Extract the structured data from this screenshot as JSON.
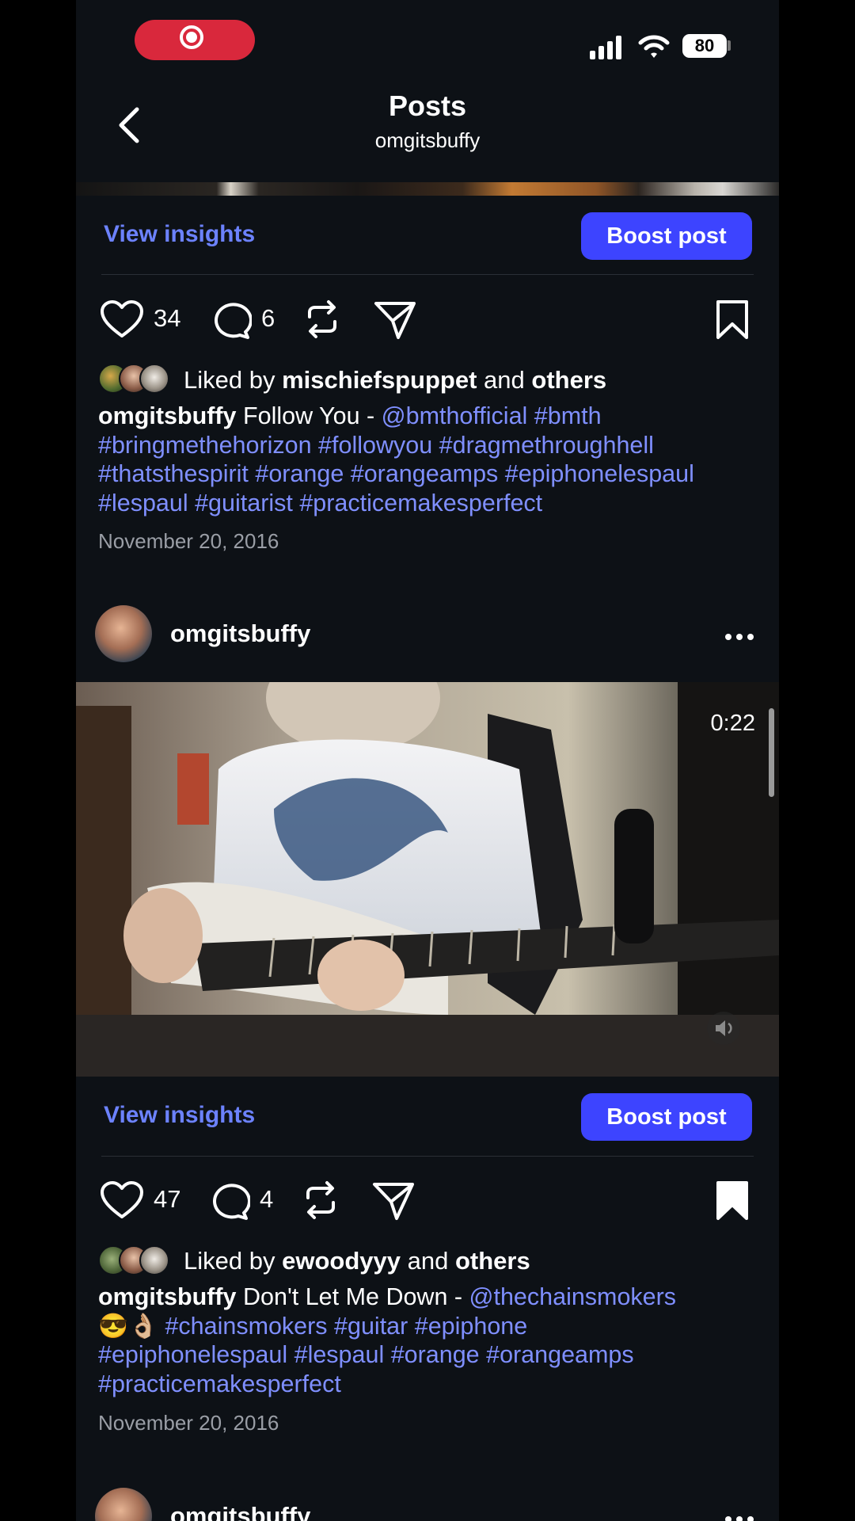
{
  "status_bar": {
    "battery": "80"
  },
  "header": {
    "title": "Posts",
    "subtitle": "omgitsbuffy"
  },
  "posts": [
    {
      "insights_label": "View insights",
      "boost_label": "Boost post",
      "likes": "34",
      "comments": "6",
      "saved": false,
      "liked_prefix": "Liked by",
      "liked_user": "mischiefspuppet",
      "liked_and": "and",
      "liked_others": "others",
      "caption_user": "omgitsbuffy",
      "caption_text": "Follow You -",
      "caption_tags_line1": "@bmthofficial #bmth",
      "caption_tags_line2": "#bringmethehorizon #followyou #dragmethroughhell",
      "caption_tags_line3": "#thatsthespirit #orange #orangeamps #epiphonelespaul",
      "caption_tags_line4": "#lespaul #guitarist #practicemakesperfect",
      "date": "November 20, 2016"
    },
    {
      "author": "omgitsbuffy",
      "video_duration": "0:22",
      "insights_label": "View insights",
      "boost_label": "Boost post",
      "likes": "47",
      "comments": "4",
      "saved": true,
      "liked_prefix": "Liked by",
      "liked_user": "ewoodyyy",
      "liked_and": "and",
      "liked_others": "others",
      "caption_user": "omgitsbuffy",
      "caption_text": "Don't Let Me Down -",
      "caption_mention": "@thechainsmokers",
      "caption_emoji": "😎👌🏼",
      "caption_tags_line2": "#chainsmokers #guitar #epiphone",
      "caption_tags_line3": "#epiphonelespaul #lespaul #orange #orangeamps",
      "caption_tags_line4": "#practicemakesperfect",
      "date": "November 20, 2016"
    },
    {
      "author": "omgitsbuffy"
    }
  ],
  "colors": {
    "background": "#0d1116",
    "accent_link": "#7f8fff",
    "boost_button": "#3d44ff",
    "record_pill": "#d9283c"
  }
}
